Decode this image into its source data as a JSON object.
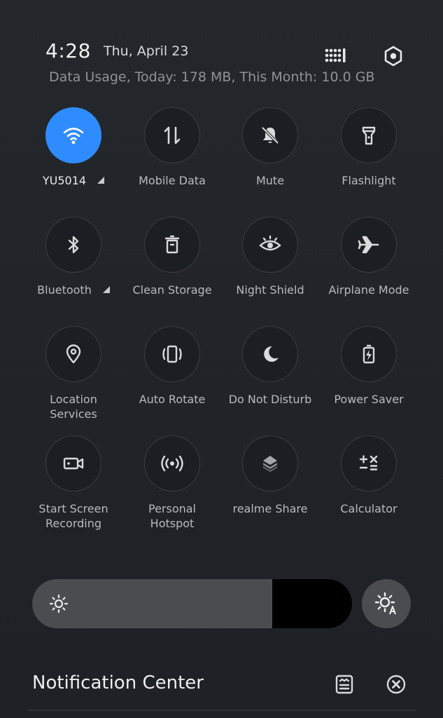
{
  "status": {
    "time": "4:28",
    "date": "Thu, April 23",
    "data_usage": "Data Usage, Today: 178 MB, This Month: 10.0 GB",
    "edit_icon": "grid-edit-icon",
    "settings_icon": "settings-hexagon-icon"
  },
  "tiles": [
    {
      "label": "YU5014",
      "icon": "wifi-icon",
      "active": true,
      "has_caret": true
    },
    {
      "label": "Mobile Data",
      "icon": "mobile-data-icon",
      "active": false
    },
    {
      "label": "Mute",
      "icon": "bell-off-icon",
      "active": false
    },
    {
      "label": "Flashlight",
      "icon": "flashlight-icon",
      "active": false
    },
    {
      "label": "Bluetooth",
      "icon": "bluetooth-icon",
      "active": false,
      "has_caret": true
    },
    {
      "label": "Clean Storage",
      "icon": "trash-icon",
      "active": false
    },
    {
      "label": "Night Shield",
      "icon": "eye-icon",
      "active": false
    },
    {
      "label": "Airplane Mode",
      "icon": "airplane-icon",
      "active": false
    },
    {
      "label": "Location\nServices",
      "icon": "location-pin-icon",
      "active": false
    },
    {
      "label": "Auto Rotate",
      "icon": "auto-rotate-icon",
      "active": false
    },
    {
      "label": "Do Not Disturb",
      "icon": "moon-icon",
      "active": false
    },
    {
      "label": "Power Saver",
      "icon": "battery-bolt-icon",
      "active": false
    },
    {
      "label": "Start Screen\nRecording",
      "icon": "video-camera-icon",
      "active": false
    },
    {
      "label": "Personal\nHotspot",
      "icon": "hotspot-icon",
      "active": false
    },
    {
      "label": "realme Share",
      "icon": "realme-share-icon",
      "active": false
    },
    {
      "label": "Calculator",
      "icon": "calculator-icon",
      "active": false
    }
  ],
  "brightness": {
    "level": 0.75,
    "sun_icon": "sun-icon",
    "auto_icon": "auto-brightness-icon"
  },
  "notifications": {
    "title": "Notification Center",
    "manage_icon": "notification-manage-icon",
    "clear_icon": "clear-all-icon"
  }
}
